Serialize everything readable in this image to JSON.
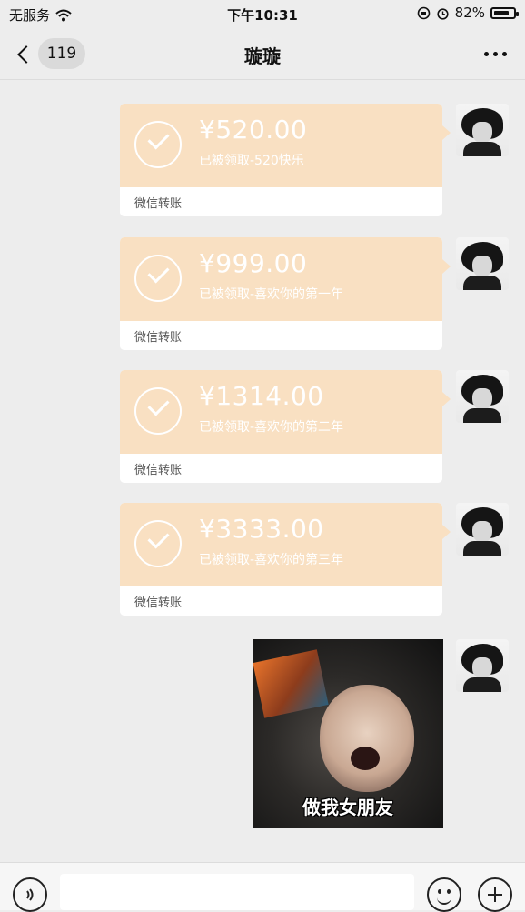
{
  "status_bar": {
    "carrier": "无服务",
    "time": "下午10:31",
    "battery_pct": "82%",
    "battery_level": 0.82
  },
  "nav": {
    "unread_count": "119",
    "title": "璇璇"
  },
  "messages": [
    {
      "type": "transfer",
      "amount": "¥520.00",
      "note": "已被领取-520快乐",
      "label": "微信转账"
    },
    {
      "type": "transfer",
      "amount": "¥999.00",
      "note": "已被领取-喜欢你的第一年",
      "label": "微信转账"
    },
    {
      "type": "transfer",
      "amount": "¥1314.00",
      "note": "已被领取-喜欢你的第二年",
      "label": "微信转账"
    },
    {
      "type": "transfer",
      "amount": "¥3333.00",
      "note": "已被领取-喜欢你的第三年",
      "label": "微信转账"
    },
    {
      "type": "sticker",
      "caption": "做我女朋友"
    }
  ],
  "colors": {
    "transfer_bg": "#f9e0c2",
    "chat_bg": "#ededed"
  }
}
